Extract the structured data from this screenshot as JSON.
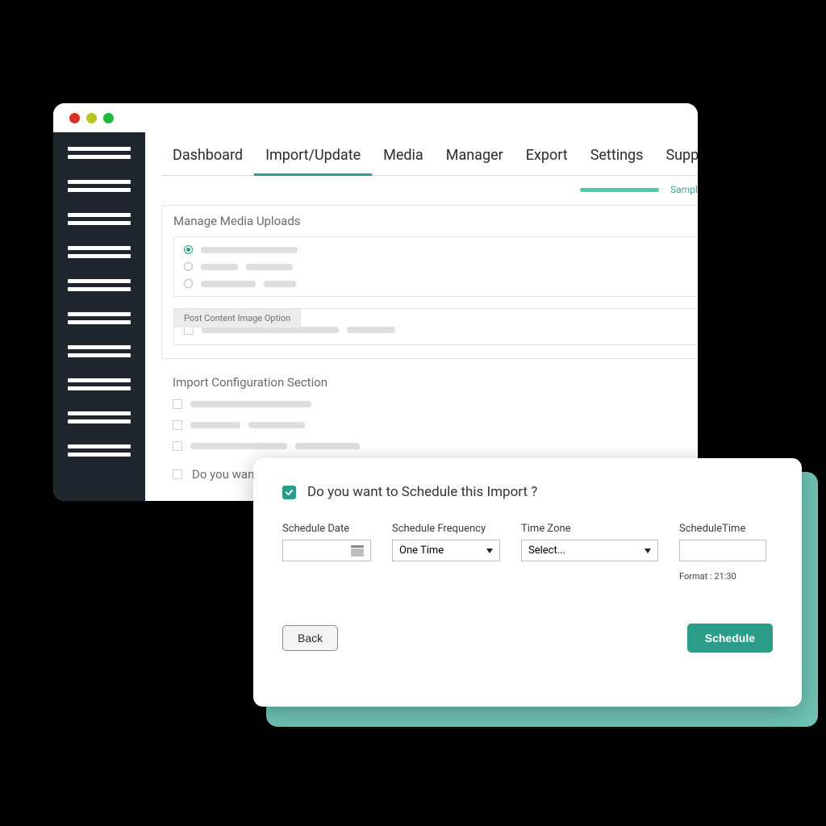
{
  "tabs": [
    "Dashboard",
    "Import/Update",
    "Media",
    "Manager",
    "Export",
    "Settings",
    "Support"
  ],
  "activeTab": 1,
  "file": {
    "name": "Sample.CSV"
  },
  "panel1": {
    "title": "Manage Media Uploads",
    "subTab": "Post Content Image Option"
  },
  "section2": {
    "title": "Import Configuration Section"
  },
  "scheduleQuestion": "Do you want to Schedule this import",
  "modal": {
    "title": "Do you want to Schedule this Import ?",
    "fields": {
      "date": {
        "label": "Schedule Date",
        "value": ""
      },
      "freq": {
        "label": "Schedule Frequency",
        "value": "One Time"
      },
      "tz": {
        "label": "Time Zone",
        "value": "Select..."
      },
      "time": {
        "label": "ScheduleTime",
        "value": "",
        "hint": "Format : 21:30"
      }
    },
    "back": "Back",
    "submit": "Schedule"
  }
}
